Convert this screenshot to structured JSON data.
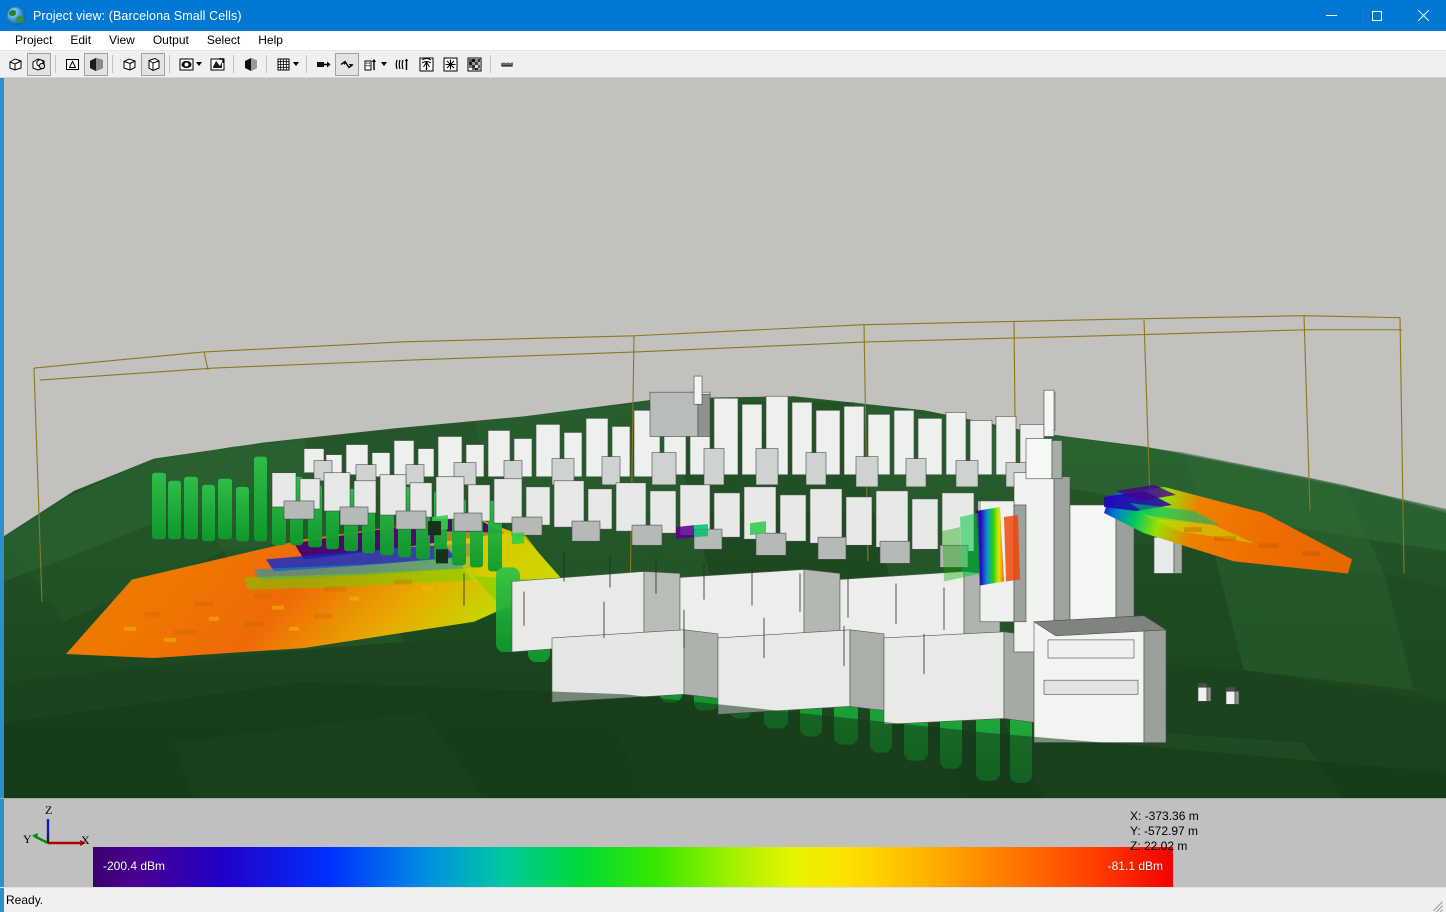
{
  "window": {
    "title": "Project view: (Barcelona Small Cells)",
    "icon": "globe-icon",
    "minimize_label": "—",
    "maximize_label": "□",
    "close_label": "×"
  },
  "menubar": {
    "items": [
      {
        "label": "Project"
      },
      {
        "label": "Edit"
      },
      {
        "label": "View"
      },
      {
        "label": "Output"
      },
      {
        "label": "Select"
      },
      {
        "label": "Help"
      }
    ]
  },
  "toolbar": {
    "groups": [
      {
        "buttons": [
          {
            "icon": "new-object-icon",
            "pressed": false
          },
          {
            "icon": "open-objects-icon",
            "pressed": true
          }
        ]
      },
      {
        "buttons": [
          {
            "icon": "wireframe-view-icon",
            "pressed": false
          },
          {
            "icon": "solid-shaded-view-icon",
            "pressed": true
          }
        ]
      },
      {
        "buttons": [
          {
            "icon": "box-view-icon",
            "pressed": false
          },
          {
            "icon": "perspective-box-icon",
            "pressed": true
          }
        ]
      },
      {
        "buttons": [
          {
            "icon": "camera-eye-icon",
            "pressed": false,
            "dropdown": true
          },
          {
            "icon": "rotate-view-icon",
            "pressed": false
          }
        ]
      },
      {
        "buttons": [
          {
            "icon": "shaded-cube-icon",
            "pressed": false
          }
        ]
      },
      {
        "buttons": [
          {
            "icon": "grid-icon",
            "pressed": false,
            "dropdown": true
          }
        ]
      },
      {
        "buttons": [
          {
            "icon": "arrow-to-target-icon",
            "pressed": false
          },
          {
            "icon": "ray-paths-icon",
            "pressed": true
          },
          {
            "icon": "building-antenna-icon",
            "pressed": false,
            "dropdown": true
          },
          {
            "icon": "signal-waves-icon",
            "pressed": false
          },
          {
            "icon": "antenna-pattern-icon",
            "pressed": false
          },
          {
            "icon": "transmitter-star-icon",
            "pressed": false
          },
          {
            "icon": "pixel-map-icon",
            "pressed": false
          }
        ]
      },
      {
        "buttons": [
          {
            "icon": "measurement-route-icon",
            "pressed": false
          }
        ]
      }
    ]
  },
  "viewport": {
    "name": "project-3d-view",
    "scene_description": "3D propagation view of Barcelona urban model with terrain, buildings and signal strength prediction overlay",
    "sky_color": "#c2c1be",
    "terrain_color": "#2f5d32",
    "building_color": "#e9ebe9",
    "vegetation_color": "#1da83c",
    "boundary_box_color": "#8a7a1a"
  },
  "axis_widget": {
    "x_label": "X",
    "y_label": "Y",
    "z_label": "Z",
    "x_color": "#c00000",
    "y_color": "#009a00",
    "z_color": "#0000cc"
  },
  "legend": {
    "name": "signal-strength-legend",
    "min_label": "-200.4 dBm",
    "max_label": "-81.1 dBm",
    "unit": "dBm",
    "min_value": -200.4,
    "max_value": -81.1,
    "colors": [
      "#3b0070",
      "#4a0092",
      "#2000c8",
      "#0030ff",
      "#0090e0",
      "#00c8a0",
      "#00d83a",
      "#36e800",
      "#9ff000",
      "#e8f400",
      "#ffe000",
      "#ffb400",
      "#ff7800",
      "#ff3c00",
      "#f40000"
    ]
  },
  "cursor_position": {
    "x": "X: -373.36 m",
    "y": "Y: -572.97 m",
    "z": "Z: 22.02 m"
  },
  "statusbar": {
    "message": "Ready.",
    "grip": "resize-grip"
  }
}
